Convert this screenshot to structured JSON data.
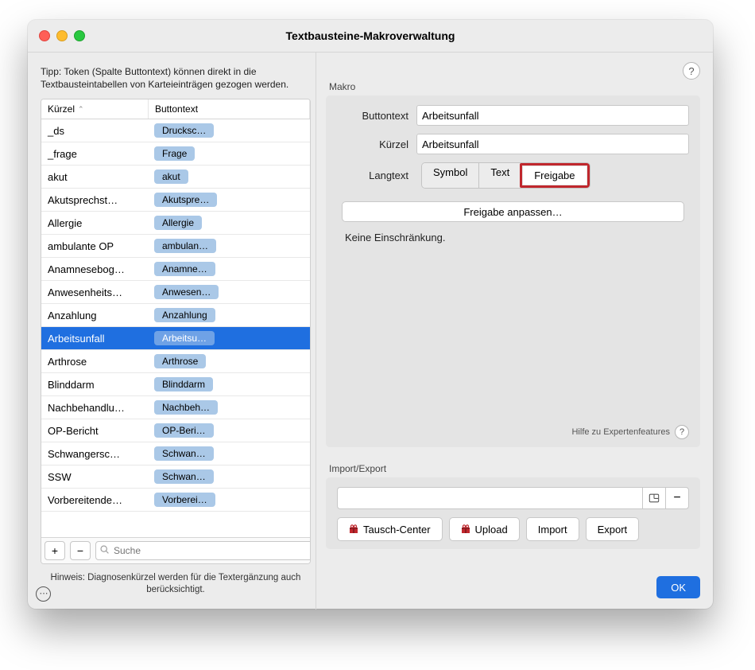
{
  "window": {
    "title": "Textbausteine-Makroverwaltung"
  },
  "left": {
    "tip": "Tipp: Token (Spalte Buttontext) können direkt in die Textbausteintabellen von Karteieinträgen gezogen werden.",
    "columns": {
      "kuerzel": "Kürzel",
      "buttontext": "Buttontext"
    },
    "rows": [
      {
        "k": "_ds",
        "b": "Drucksc…"
      },
      {
        "k": "_frage",
        "b": "Frage"
      },
      {
        "k": "akut",
        "b": "akut"
      },
      {
        "k": "Akutsprechst…",
        "b": "Akutspre…"
      },
      {
        "k": "Allergie",
        "b": "Allergie"
      },
      {
        "k": "ambulante OP",
        "b": "ambulan…"
      },
      {
        "k": "Anamnesebog…",
        "b": "Anamne…"
      },
      {
        "k": "Anwesenheits…",
        "b": "Anwesen…"
      },
      {
        "k": "Anzahlung",
        "b": "Anzahlung"
      },
      {
        "k": "Arbeitsunfall",
        "b": "Arbeitsu…",
        "selected": true
      },
      {
        "k": "Arthrose",
        "b": "Arthrose"
      },
      {
        "k": "Blinddarm",
        "b": "Blinddarm"
      },
      {
        "k": "Nachbehandlu…",
        "b": "Nachbeh…"
      },
      {
        "k": "OP-Bericht",
        "b": "OP-Beri…"
      },
      {
        "k": "Schwangersc…",
        "b": "Schwan…"
      },
      {
        "k": "SSW",
        "b": "Schwan…"
      },
      {
        "k": "Vorbereitende…",
        "b": "Vorberei…"
      }
    ],
    "search_placeholder": "Suche",
    "hint": "Hinweis: Diagnosenkürzel werden für die Textergänzung auch berücksichtigt."
  },
  "makro": {
    "section": "Makro",
    "buttontext_label": "Buttontext",
    "buttontext_value": "Arbeitsunfall",
    "kuerzel_label": "Kürzel",
    "kuerzel_value": "Arbeitsunfall",
    "langtext_label": "Langtext",
    "tabs": {
      "symbol": "Symbol",
      "text": "Text",
      "freigabe": "Freigabe"
    },
    "adjust_button": "Freigabe anpassen…",
    "restriction": "Keine Einschränkung.",
    "expert_hint": "Hilfe zu Expertenfeatures"
  },
  "ie": {
    "section": "Import/Export",
    "tausch": "Tausch-Center",
    "upload": "Upload",
    "import": "Import",
    "export": "Export"
  },
  "ok": "OK"
}
